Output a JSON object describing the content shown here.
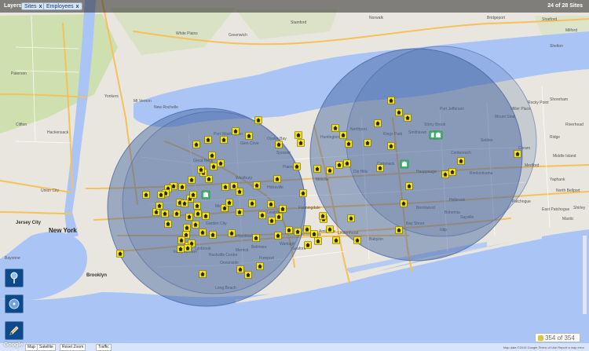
{
  "layers": {
    "label": "Layers:",
    "chips": [
      {
        "label": "Sites",
        "close": "x"
      },
      {
        "label": "Employees",
        "close": "x"
      }
    ],
    "count_text": "24 of 28 Sites"
  },
  "tools": [
    {
      "icon": "location-pin-icon"
    },
    {
      "icon": "radius-icon"
    },
    {
      "icon": "pencil-icon"
    }
  ],
  "map_controls": {
    "map": "Map",
    "satellite": "Satellite",
    "reset_zoom": "Reset Zoom",
    "traffic": "Traffic"
  },
  "counter": {
    "text": "354 of 354"
  },
  "legal": "Map data ©2015 Google   Terms of Use   Report a map error",
  "place_labels": [
    {
      "name": "Yonkers"
    },
    {
      "name": "White Plains"
    },
    {
      "name": "Greenwich"
    },
    {
      "name": "Mt Vernon"
    },
    {
      "name": "New Rochelle"
    },
    {
      "name": "Stamford"
    },
    {
      "name": "Norwalk"
    },
    {
      "name": "Bridgeport"
    },
    {
      "name": "Stratford"
    },
    {
      "name": "Milford"
    },
    {
      "name": "Shelton"
    },
    {
      "name": "Paterson"
    },
    {
      "name": "Clifton"
    },
    {
      "name": "Hackensack"
    },
    {
      "name": "Union City"
    },
    {
      "name": "Jersey City"
    },
    {
      "name": "New York"
    },
    {
      "name": "Bayonne"
    },
    {
      "name": "Brooklyn"
    },
    {
      "name": "Huntington"
    },
    {
      "name": "Melville"
    },
    {
      "name": "Hicksville"
    },
    {
      "name": "Levittown"
    },
    {
      "name": "Babylon"
    },
    {
      "name": "Bay Shore"
    },
    {
      "name": "Islip"
    },
    {
      "name": "Brentwood"
    },
    {
      "name": "Smithtown"
    },
    {
      "name": "Ronkonkoma"
    },
    {
      "name": "Selden"
    },
    {
      "name": "Medford"
    },
    {
      "name": "Coram"
    },
    {
      "name": "Patchogue"
    },
    {
      "name": "East Patchogue"
    },
    {
      "name": "North Bellport"
    },
    {
      "name": "Port Jefferson"
    },
    {
      "name": "Stony Brook"
    },
    {
      "name": "Long Beach"
    },
    {
      "name": "Oceanside"
    },
    {
      "name": "Freeport"
    },
    {
      "name": "Hempstead"
    },
    {
      "name": "Garden City"
    },
    {
      "name": "Glen Cove"
    },
    {
      "name": "Valley Stream"
    },
    {
      "name": "Lynbrook"
    },
    {
      "name": "Rockville Centre"
    },
    {
      "name": "Lindenhurst"
    },
    {
      "name": "Amityville"
    },
    {
      "name": "Dix Hills"
    },
    {
      "name": "Commack"
    },
    {
      "name": "Hauppauge"
    },
    {
      "name": "Centereach"
    },
    {
      "name": "Great Neck"
    },
    {
      "name": "Port Washington"
    },
    {
      "name": "Westbury"
    },
    {
      "name": "Plainview"
    },
    {
      "name": "Farmingdale"
    },
    {
      "name": "Massapequa"
    },
    {
      "name": "Wantagh"
    },
    {
      "name": "Seaford"
    },
    {
      "name": "Bellmore"
    },
    {
      "name": "Merrick"
    },
    {
      "name": "Mineola"
    },
    {
      "name": "Syosset"
    },
    {
      "name": "Northport"
    },
    {
      "name": "Kings Park"
    },
    {
      "name": "Oyster Bay"
    },
    {
      "name": "Sayville"
    },
    {
      "name": "Holbrook"
    },
    {
      "name": "Bohemia"
    },
    {
      "name": "Mount Sinai"
    },
    {
      "name": "Miller Place"
    },
    {
      "name": "Rocky Point"
    },
    {
      "name": "Shoreham"
    },
    {
      "name": "Ridge"
    },
    {
      "name": "Yaphank"
    },
    {
      "name": "Mastic"
    },
    {
      "name": "Shirley"
    },
    {
      "name": "Middle Island"
    },
    {
      "name": "Riverhead"
    }
  ],
  "colors": {
    "water": "#a9c4f5",
    "land": "#e8e6de",
    "green": "#c9e0a8",
    "highway": "#f6c05a",
    "circle_fill": "#3f5f9d",
    "marker": "#f4e21a"
  }
}
